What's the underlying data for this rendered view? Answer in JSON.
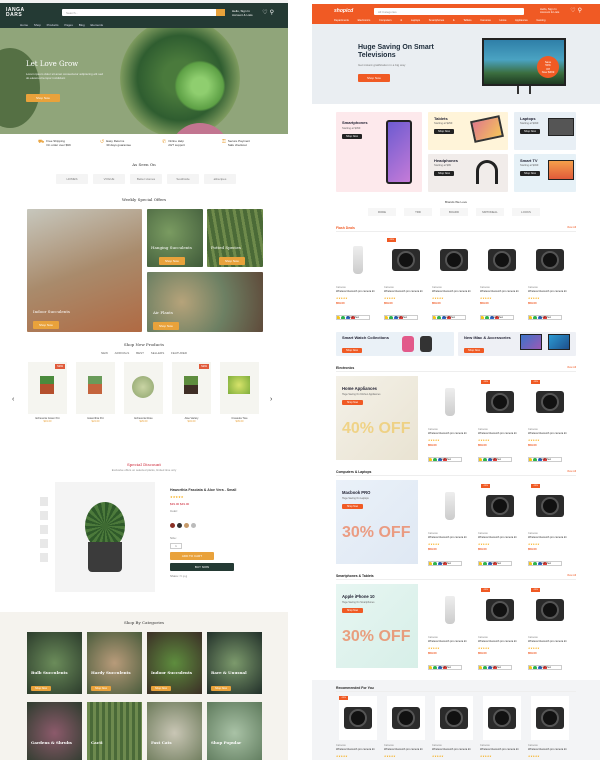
{
  "left": {
    "logo": "IANGA\nDARS",
    "search_placeholder": "Search...",
    "account": "Hello, Sign In\nAccount & Lists",
    "nav": "Home  Shop  Products  Pages  Blog  Elements",
    "hero": {
      "title": "Let Love Grow",
      "text": "Lorem ipsum dolor sit amet consectetur adipiscing elit sed do eiusmod tempor incididunt",
      "button": "Shop Now"
    },
    "features": [
      "Free Shipping\nOn order over $99",
      "Easy Returns\n30 days guarantee",
      "Online Help\n24/7 support",
      "Secure Payment\nSafe checkout"
    ],
    "seen_title": "As Seen On",
    "brands": [
      "HOMES",
      "VOGUE",
      "Better Homes",
      "Southside",
      "allrecipes"
    ],
    "weekly_title": "Weekly Special Offers",
    "weekly": [
      {
        "label": "Indoor Succulents",
        "btn": "Shop Now"
      },
      {
        "label": "Hanging Succulents",
        "btn": "Shop Now"
      },
      {
        "label": "Potted Species",
        "btn": "Shop Now"
      },
      {
        "label": "Air Plants",
        "btn": "Shop Now"
      }
    ],
    "new_title": "Shop New Products",
    "new_tabs": "NEW ARRIVALS   BEST SELLERS   FEATURED",
    "new_products": [
      {
        "name": "Echeveria Green Pot",
        "price": "$19.00",
        "badge": "NEW"
      },
      {
        "name": "Haworthia Pot",
        "price": "$24.00",
        "badge": ""
      },
      {
        "name": "Echeveria Rose",
        "price": "$29.00",
        "badge": ""
      },
      {
        "name": "Aloe Variety",
        "price": "$34.00",
        "badge": "NEW"
      },
      {
        "name": "Crassula Tree",
        "price": "$39.00",
        "badge": ""
      }
    ],
    "disc_title": "Special Discount",
    "disc_sub": "Exclusive offers on selected plants, limited time only",
    "prod": {
      "name": "Haworthia Fasciata & Aloe Vera - Small",
      "rating": "★★★★★",
      "row1": "$39.00  $49.00",
      "row2": "Color:",
      "row3": "Size:",
      "qty": "1",
      "cart": "ADD TO CART",
      "buy": "BUY NOW",
      "share": "Share: f t p g"
    },
    "cat_title": "Shop By Categories",
    "cats": [
      "Bulb Succulents",
      "Hardy Succulents",
      "Indoor Succulents",
      "Rare & Unusual",
      "Gardens & Shrubs",
      "Cacti",
      "Fast Cats",
      "Shop Popular"
    ],
    "cat_btn": "Shop Now"
  },
  "right": {
    "logo": "shopicd",
    "search_placeholder": "All Categories",
    "account": "Hello, Sign In\nAccount & Lists",
    "nav": "Departments  Electronics  Computers & Laptops  Smartphones & Tablets  Cameras  Home Appliances  Gaming",
    "hero": {
      "title": "Huge Saving On Smart Televisions",
      "text": "Get instant gratification in a big way",
      "button": "Shop Now",
      "badge": "Save\n50%\nOff\nNow $699"
    },
    "promos": [
      {
        "title": "Smartphones",
        "sub": "Starting at $399",
        "btn": "Shop Now"
      },
      {
        "title": "Tablets",
        "sub": "Starting at $299",
        "btn": "Shop Now"
      },
      {
        "title": "Laptops",
        "sub": "Starting at $499",
        "btn": "Shop Now"
      },
      {
        "title": "Headphones",
        "sub": "Starting at $99",
        "btn": "Shop Now"
      },
      {
        "title": "Smart TV",
        "sub": "Starting at $499",
        "btn": "Shop Now"
      }
    ],
    "brands_title": "Brands We Love",
    "brands": [
      "RODE",
      "TRD",
      "BOARD",
      "MRTONEAL",
      "LOOKS"
    ],
    "flash": {
      "title": "Flash Deals",
      "link": "View All"
    },
    "product": {
      "cat": "Cameras",
      "name": "Wireless bluetooth pro camera kit",
      "stars": "★★★★★",
      "price": "$59.00",
      "qv": "Quick View"
    },
    "product_badge": "-15%",
    "watch": {
      "title": "Smart Watch Collections",
      "btn": "Shop Now"
    },
    "imac": {
      "title": "New iMac & Accessories",
      "btn": "Shop Now"
    },
    "sections": [
      {
        "title": "Electronics",
        "link": "View All",
        "banner": "Home Appliances",
        "sub": "Huge Saving On Kitchen Appliances",
        "btn": "Shop Now",
        "pct": "40% OFF"
      },
      {
        "title": "Computers & Laptops",
        "link": "View All",
        "banner": "Macbook PRO",
        "sub": "Huge Saving On Laptops",
        "btn": "Shop Now",
        "pct": "30% OFF"
      },
      {
        "title": "Smartphones & Tablets",
        "link": "View All",
        "banner": "Apple iPhone 10",
        "sub": "Huge Saving On Smartphones",
        "btn": "Shop Now",
        "pct": "30% OFF"
      }
    ],
    "rec_title": "Recommended For You",
    "colors": {
      "accent": "#f05a24"
    }
  },
  "colors": {
    "left_dark": "#243a34",
    "left_accent": "#e9a23b",
    "right_accent": "#f05a24"
  }
}
